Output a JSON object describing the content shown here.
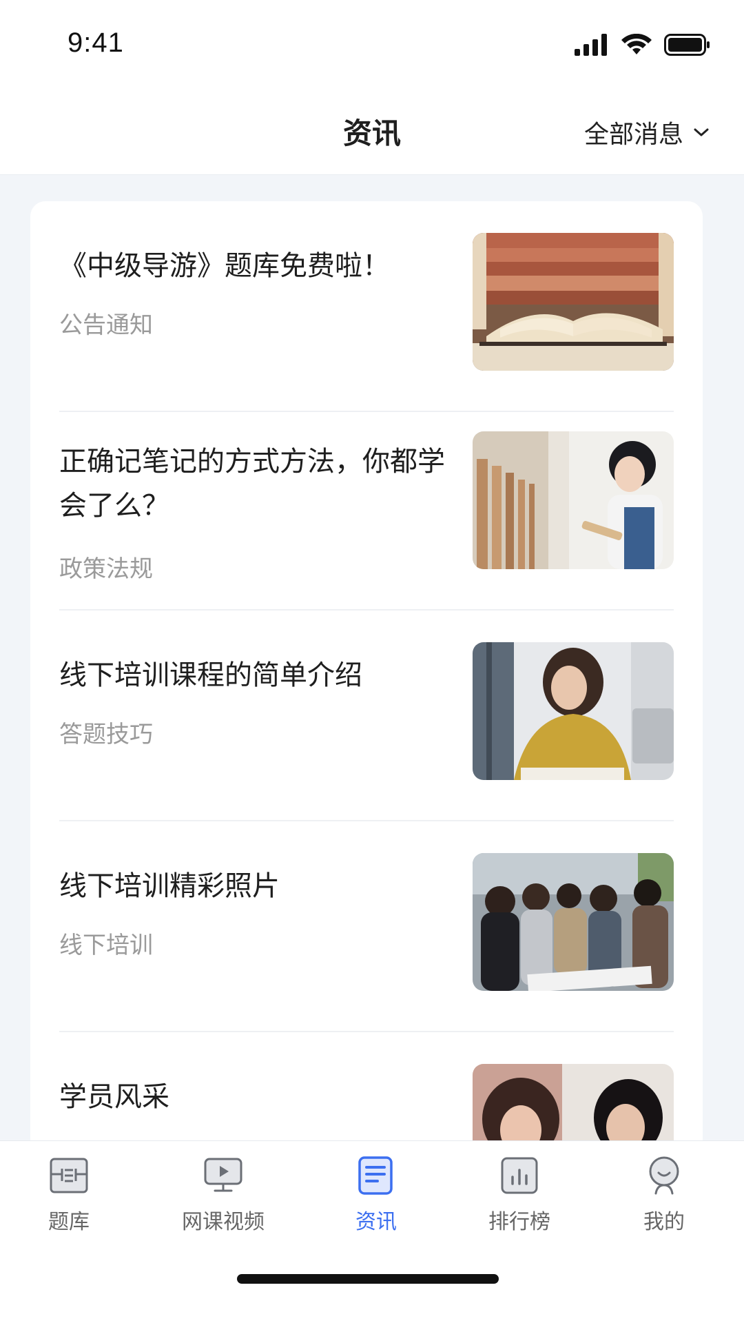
{
  "status_bar": {
    "time": "9:41"
  },
  "header": {
    "title": "资讯",
    "filter_label": "全部消息"
  },
  "articles": [
    {
      "title": "《中级导游》题库免费啦！",
      "tag": "公告通知",
      "image": "books-photo"
    },
    {
      "title": "正确记笔记的方式方法，你都学会了么？",
      "tag": "政策法规",
      "image": "student-library-photo"
    },
    {
      "title": "线下培训课程的简单介绍",
      "tag": "答题技巧",
      "image": "student-studying-photo"
    },
    {
      "title": "线下培训精彩照片",
      "tag": "线下培训",
      "image": "group-study-photo"
    },
    {
      "title": "学员风采",
      "tag": "",
      "image": "students-photo"
    }
  ],
  "tabbar": {
    "items": [
      {
        "label": "题库",
        "icon": "question-bank-icon",
        "active": false
      },
      {
        "label": "网课视频",
        "icon": "video-course-icon",
        "active": false
      },
      {
        "label": "资讯",
        "icon": "news-icon",
        "active": true
      },
      {
        "label": "排行榜",
        "icon": "ranking-icon",
        "active": false
      },
      {
        "label": "我的",
        "icon": "profile-icon",
        "active": false
      }
    ]
  },
  "colors": {
    "accent": "#3c6ff0",
    "background": "#f2f5f9",
    "card": "#ffffff",
    "tag_text": "#9a9a9a"
  }
}
